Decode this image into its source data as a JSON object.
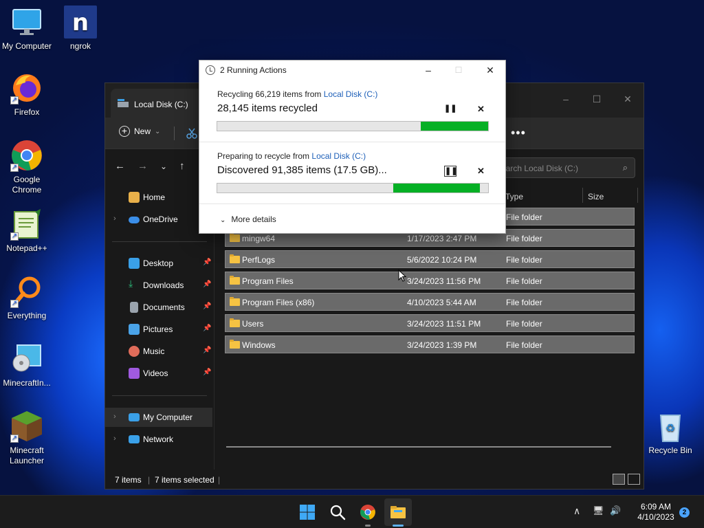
{
  "desktop": {
    "icons": [
      {
        "label": "My Computer",
        "icon": "monitor-icon"
      },
      {
        "label": "ngrok",
        "icon": "ngrok-icon"
      },
      {
        "label": "Firefox",
        "icon": "firefox-icon"
      },
      {
        "label": "Google Chrome",
        "icon": "chrome-icon"
      },
      {
        "label": "Notepad++",
        "icon": "notepadpp-icon"
      },
      {
        "label": "Everything",
        "icon": "everything-icon"
      },
      {
        "label": "MinecraftIn...",
        "icon": "minecraft-installer-icon"
      },
      {
        "label": "Minecraft Launcher",
        "icon": "minecraft-icon"
      },
      {
        "label": "Recycle Bin",
        "icon": "recycle-bin-icon"
      }
    ]
  },
  "explorer": {
    "tab_title": "Local Disk (C:)",
    "toolbar": {
      "new_label": "New",
      "new_chevron": "⌄",
      "more_label": "•••"
    },
    "window_buttons": {
      "minimize": "–",
      "maximize": "☐",
      "close": "✕"
    },
    "nav": {
      "back": "←",
      "forward": "→",
      "recent": "⌄",
      "up": "↑"
    },
    "search": {
      "placeholder": "earch Local Disk (C:)",
      "icon": "search-icon"
    },
    "sidebar": {
      "items": [
        {
          "label": "Home",
          "icon": "home-icon",
          "color": "#e8b04a"
        },
        {
          "label": "OneDrive",
          "icon": "onedrive-icon",
          "color": "#3b8ee8",
          "expandable": true
        },
        {
          "label": "Desktop",
          "icon": "desktop-icon",
          "color": "#3aa0e8",
          "pinned": true
        },
        {
          "label": "Downloads",
          "icon": "download-icon",
          "color": "#2ec27e",
          "pinned": true
        },
        {
          "label": "Documents",
          "icon": "documents-icon",
          "color": "#9aa3ad",
          "pinned": true
        },
        {
          "label": "Pictures",
          "icon": "pictures-icon",
          "color": "#4aa3e8",
          "pinned": true
        },
        {
          "label": "Music",
          "icon": "music-icon",
          "color": "#e06c5a",
          "pinned": true
        },
        {
          "label": "Videos",
          "icon": "videos-icon",
          "color": "#a05ae0",
          "pinned": true
        },
        {
          "label": "My Computer",
          "icon": "computer-icon",
          "color": "#3aa0e8",
          "expandable": true,
          "selected": true
        },
        {
          "label": "Network",
          "icon": "network-icon",
          "color": "#3aa0e8",
          "expandable": true
        }
      ]
    },
    "columns": {
      "type": "Type",
      "size": "Size"
    },
    "rows": [
      {
        "name": "",
        "date": "",
        "type": "File folder"
      },
      {
        "name": "mingw64",
        "date": "1/17/2023 2:47 PM",
        "type": "File folder"
      },
      {
        "name": "PerfLogs",
        "date": "5/6/2022 10:24 PM",
        "type": "File folder"
      },
      {
        "name": "Program Files",
        "date": "3/24/2023 11:56 PM",
        "type": "File folder"
      },
      {
        "name": "Program Files (x86)",
        "date": "4/10/2023 5:44 AM",
        "type": "File folder"
      },
      {
        "name": "Users",
        "date": "3/24/2023 11:51 PM",
        "type": "File folder"
      },
      {
        "name": "Windows",
        "date": "3/24/2023 1:39 PM",
        "type": "File folder"
      }
    ],
    "status": {
      "count": "7 items",
      "selected": "7 items selected",
      "separator": "|"
    }
  },
  "dialog": {
    "title": "2 Running Actions",
    "window_buttons": {
      "minimize": "–",
      "maximize": "☐",
      "close": "✕"
    },
    "actions": [
      {
        "line1_prefix": "Recycling 66,219 items from ",
        "line1_link": "Local Disk (C:)",
        "line2": "28,145 items recycled",
        "progress": 0.25,
        "pause": "❚❚",
        "cancel": "✕"
      },
      {
        "line1_prefix": "Preparing to recycle from ",
        "line1_link": "Local Disk (C:)",
        "line2": "Discovered 91,385 items (17.5 GB)...",
        "progress": 0.32,
        "pause": "❚❚",
        "cancel": "✕"
      }
    ],
    "more_details": "More details",
    "more_chevron": "⌄",
    "colors": {
      "progress": "#06b025",
      "link": "#1d5fb8"
    }
  },
  "taskbar": {
    "icons": [
      "windows-start-icon",
      "search-icon",
      "chrome-icon",
      "file-explorer-icon"
    ],
    "tray": {
      "chevron": "∧",
      "network": "🖥",
      "volume": "🔊"
    },
    "time": "6:09 AM",
    "date": "4/10/2023",
    "notifications": "2"
  }
}
